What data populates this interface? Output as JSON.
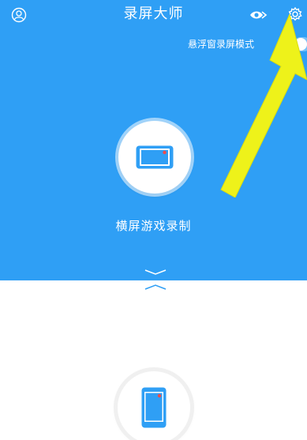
{
  "header": {
    "title": "录屏大师",
    "icons": {
      "user": "user-circle-icon",
      "share": "share-eye-icon",
      "settings": "gear-icon"
    }
  },
  "floating_mode": {
    "label": "悬浮窗录屏模式",
    "enabled": false
  },
  "modes": [
    {
      "label": "横屏游戏录制",
      "icon": "phone-landscape-icon"
    },
    {
      "label": "",
      "icon": "phone-portrait-icon"
    }
  ],
  "colors": {
    "primary_blue": "#2f9ff5",
    "accent_red": "#ef4b4b",
    "annotation_yellow": "#eef21a"
  }
}
